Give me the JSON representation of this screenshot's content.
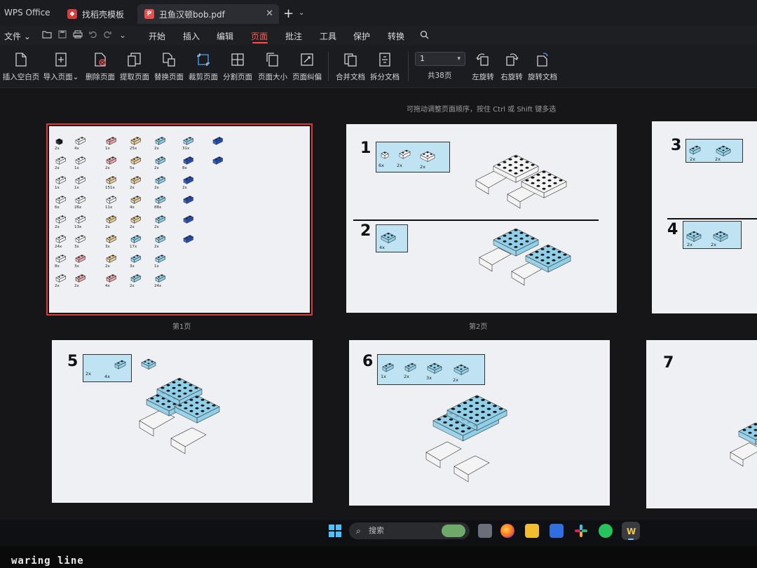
{
  "titlebar": {
    "app_name": "WPS Office",
    "tabs": [
      {
        "label": "找稻壳模板"
      },
      {
        "label": "丑鱼汉顿bob.pdf",
        "active": true
      }
    ],
    "close_symbol": "✕",
    "new_tab_symbol": "+",
    "new_tab_dropdown": "⌄"
  },
  "menubar": {
    "file_label": "文件",
    "items": [
      "开始",
      "插入",
      "编辑",
      "页面",
      "批注",
      "工具",
      "保护",
      "转换"
    ],
    "active_item": "页面",
    "accent_color": "#ff4d4d"
  },
  "ribbon": {
    "buttons": [
      {
        "label": "插入空白页",
        "icon": "blank-page-icon"
      },
      {
        "label": "导入页面",
        "icon": "import-page-icon"
      },
      {
        "label": "删除页面",
        "icon": "delete-page-icon"
      },
      {
        "label": "提取页面",
        "icon": "extract-page-icon"
      },
      {
        "label": "替换页面",
        "icon": "replace-page-icon"
      },
      {
        "label": "裁剪页面",
        "icon": "crop-page-icon"
      },
      {
        "label": "分割页面",
        "icon": "split-page-icon"
      },
      {
        "label": "页面大小",
        "icon": "page-size-icon"
      },
      {
        "label": "页面纠偏",
        "icon": "deskew-page-icon"
      },
      {
        "label": "合并文档",
        "icon": "merge-doc-icon"
      },
      {
        "label": "拆分文档",
        "icon": "split-doc-icon"
      },
      {
        "label": "左旋转",
        "icon": "rotate-left-icon"
      },
      {
        "label": "右旋转",
        "icon": "rotate-right-icon"
      },
      {
        "label": "旋转文档",
        "icon": "rotate-doc-icon"
      }
    ],
    "page_select_value": "1",
    "page_count": "共38页"
  },
  "workspace": {
    "hint": "可拖动调整页面顺序，按住 Ctrl 或 Shift 键多选",
    "page_labels": [
      "第1页",
      "第2页"
    ],
    "steps": [
      "1",
      "2",
      "3",
      "4",
      "5",
      "6",
      "7"
    ],
    "page1_quantities": [
      "2x",
      "2x",
      "1x",
      "6x",
      "2x",
      "24x",
      "8x",
      "2x",
      "4x",
      "1x",
      "1x",
      "26x",
      "13x",
      "3x",
      "3x",
      "2x",
      "1x",
      "2x",
      "151x",
      "11x",
      "2x",
      "3x",
      "2x",
      "4x",
      "25x",
      "5x",
      "2x",
      "4x",
      "2x",
      "17x",
      "3x",
      "2x",
      "2x",
      "2x",
      "2x",
      "88x",
      "2x",
      "2x",
      "1x",
      "24x",
      "31x",
      "8x",
      "2x"
    ],
    "page2_quantities": [
      "6x",
      "2x",
      "2x",
      "4x"
    ],
    "page3_quantities": [
      "2x",
      "2x",
      "2x",
      "2x"
    ],
    "page5_quantities": [
      "2x",
      "4x"
    ],
    "page6_quantities": [
      "1x",
      "2x",
      "3x",
      "2x"
    ],
    "brick_colors": {
      "light_blue": "#8fcfe8",
      "dark_blue": "#1f4fbf",
      "white": "#f4f4f4",
      "pink": "#e9a4a8",
      "tan": "#e9cc98",
      "stud_dark": "#111111"
    }
  },
  "taskbar": {
    "search_placeholder": "搜索",
    "apps": [
      "windows-start-icon",
      "search-icon",
      "weather-icon",
      "task-view-icon",
      "firefox-icon",
      "file-explorer-icon",
      "feishu-icon",
      "slack-icon",
      "wechat-icon",
      "wps-icon"
    ]
  },
  "bezel": {
    "sticker_text": "waring line"
  }
}
